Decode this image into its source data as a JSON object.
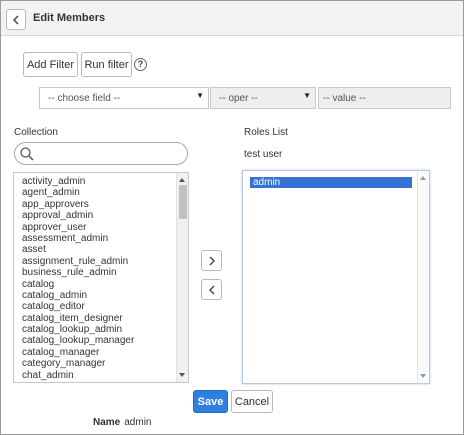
{
  "header": {
    "title": "Edit Members",
    "back_icon": "chevron-left-icon"
  },
  "filters": {
    "add_filter_label": "Add Filter",
    "run_filter_label": "Run filter",
    "help_icon": "help-icon",
    "help_glyph": "?",
    "field_select": "-- choose field --",
    "oper_select": "-- oper --",
    "value_field": "-- value --"
  },
  "collection": {
    "label": "Collection",
    "search_placeholder": "",
    "items": [
      "activity_admin",
      "agent_admin",
      "app_approvers",
      "approval_admin",
      "approver_user",
      "assessment_admin",
      "asset",
      "assignment_rule_admin",
      "business_rule_admin",
      "catalog",
      "catalog_admin",
      "catalog_editor",
      "catalog_item_designer",
      "catalog_lookup_admin",
      "catalog_lookup_manager",
      "catalog_manager",
      "category_manager",
      "chat_admin"
    ]
  },
  "roles": {
    "label": "Roles List",
    "user": "test user",
    "items": [
      "admin"
    ]
  },
  "actions": {
    "save_label": "Save",
    "cancel_label": "Cancel"
  },
  "footer": {
    "name_label": "Name",
    "name_value": "admin"
  },
  "colors": {
    "primary": "#2e7fde",
    "selected_row": "#3572d1"
  }
}
